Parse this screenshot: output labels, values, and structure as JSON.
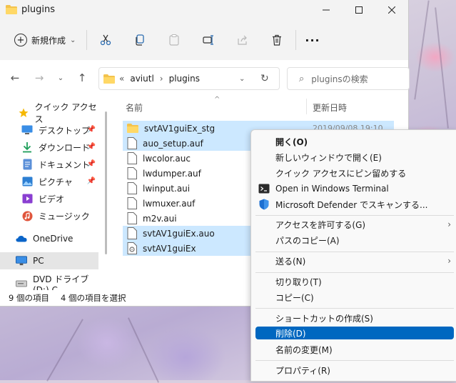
{
  "window": {
    "title": "plugins"
  },
  "toolbar": {
    "new_label": "新規作成"
  },
  "address": {
    "root": "aviutl",
    "folder": "plugins",
    "prefix": "«"
  },
  "search": {
    "placeholder": "pluginsの検索"
  },
  "sidebar": {
    "items": [
      {
        "label": "クイック アクセス",
        "icon": "star-icon"
      },
      {
        "label": "デスクトップ",
        "icon": "desktop-icon",
        "pinned": true
      },
      {
        "label": "ダウンロード",
        "icon": "download-icon",
        "pinned": true
      },
      {
        "label": "ドキュメント",
        "icon": "document-icon",
        "pinned": true
      },
      {
        "label": "ピクチャ",
        "icon": "picture-icon",
        "pinned": true
      },
      {
        "label": "ビデオ",
        "icon": "video-icon"
      },
      {
        "label": "ミュージック",
        "icon": "music-icon"
      },
      {
        "label": "OneDrive",
        "icon": "cloud-icon"
      },
      {
        "label": "PC",
        "icon": "pc-icon",
        "selected": true
      },
      {
        "label": "DVD ドライブ (D:) C",
        "icon": "dvd-icon"
      }
    ]
  },
  "columns": {
    "name": "名前",
    "modified": "更新日時"
  },
  "files": [
    {
      "name": "svtAV1guiEx_stg",
      "type": "folder",
      "selected": true,
      "date": "2019/09/08 19:10"
    },
    {
      "name": "auo_setup.auf",
      "type": "file",
      "selected": true
    },
    {
      "name": "lwcolor.auc",
      "type": "file",
      "selected": false
    },
    {
      "name": "lwdumper.auf",
      "type": "file",
      "selected": false
    },
    {
      "name": "lwinput.aui",
      "type": "file",
      "selected": false
    },
    {
      "name": "lwmuxer.auf",
      "type": "file",
      "selected": false
    },
    {
      "name": "m2v.aui",
      "type": "file",
      "selected": false
    },
    {
      "name": "svtAV1guiEx.auo",
      "type": "file",
      "selected": true
    },
    {
      "name": "svtAV1guiEx",
      "type": "config",
      "selected": true
    }
  ],
  "status": {
    "count": "9 個の項目",
    "selected": "4 個の項目を選択"
  },
  "context_menu": {
    "items": [
      {
        "label": "開く(O)",
        "bold": true
      },
      {
        "label": "新しいウィンドウで開く(E)"
      },
      {
        "label": "クイック アクセスにピン留めする"
      },
      {
        "label": "Open in Windows Terminal",
        "icon": "terminal-icon"
      },
      {
        "label": "Microsoft Defender でスキャンする...",
        "icon": "defender-shield-icon"
      },
      {
        "label": "アクセスを許可する(G)",
        "submenu": true
      },
      {
        "label": "パスのコピー(A)"
      },
      {
        "label": "送る(N)",
        "submenu": true
      },
      {
        "label": "切り取り(T)"
      },
      {
        "label": "コピー(C)"
      },
      {
        "label": "ショートカットの作成(S)"
      },
      {
        "label": "削除(D)",
        "highlighted": true
      },
      {
        "label": "名前の変更(M)"
      },
      {
        "label": "プロパティ(R)"
      }
    ]
  },
  "colors": {
    "selection": "#cce8ff",
    "highlight": "#0067c0",
    "folder": "#f3c34d"
  }
}
